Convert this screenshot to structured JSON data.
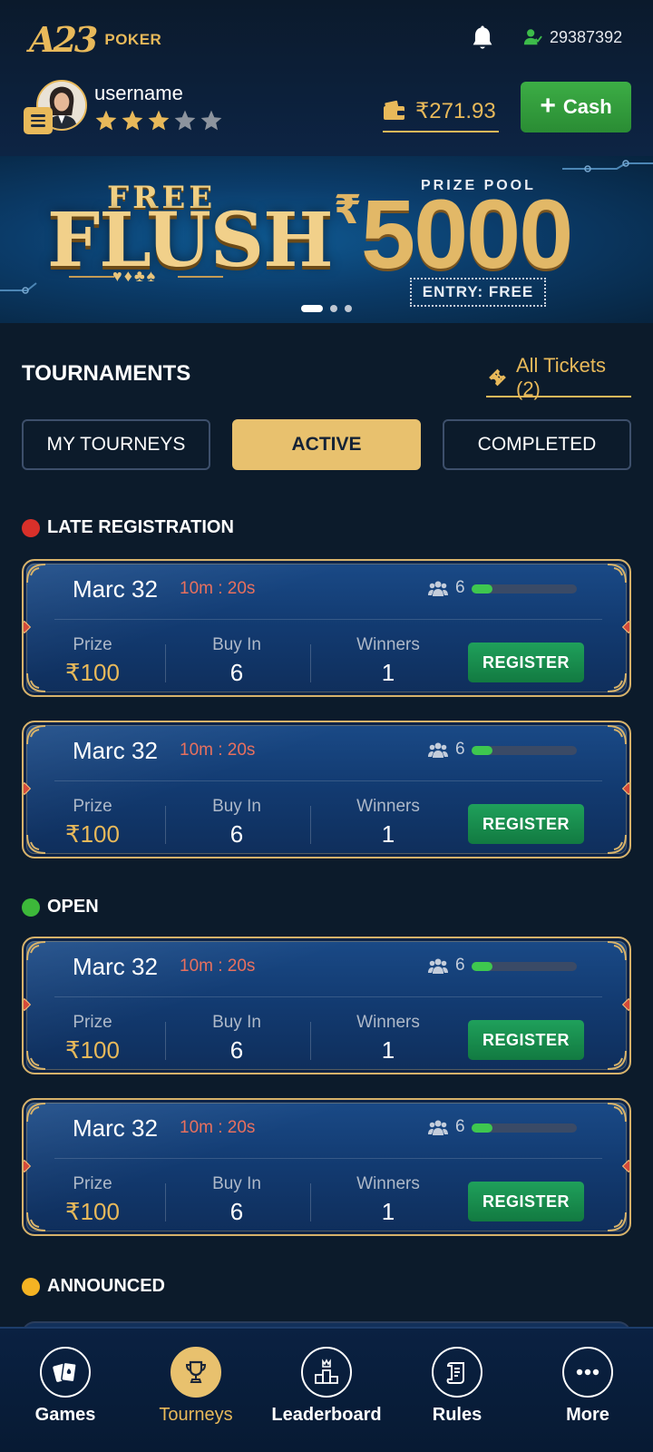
{
  "header": {
    "logo_mark": "A23",
    "logo_text": "POKER",
    "player_id": "29387392",
    "username": "username",
    "star_rating": 3,
    "star_total": 5,
    "wallet_amount": "₹271.93",
    "cash_button_plus": "+",
    "cash_button_label": "Cash"
  },
  "banner": {
    "free": "FREE",
    "flush": "FLUSH",
    "suits": "♥♦♣♠",
    "prize_label": "PRIZE POOL",
    "prize_currency": "₹",
    "prize_amount": "5000",
    "entry": "ENTRY: FREE",
    "slide_count": 3,
    "active_slide": 1
  },
  "tournaments": {
    "title": "TOURNAMENTS",
    "tickets_label": "All Tickets (2)",
    "tabs": [
      {
        "label": "MY TOURNEYS",
        "active": false
      },
      {
        "label": "ACTIVE",
        "active": true
      },
      {
        "label": "COMPLETED",
        "active": false
      }
    ]
  },
  "sections": [
    {
      "label": "LATE REGISTRATION",
      "color": "#d9302a"
    },
    {
      "label": "OPEN",
      "color": "#3db83a"
    },
    {
      "label": "ANNOUNCED",
      "color": "#f4b323"
    }
  ],
  "cards": [
    {
      "name": "Marc 32",
      "timer": "10m : 20s",
      "players": "6",
      "fill": 0.2,
      "prize_label": "Prize",
      "prize": "₹100",
      "buyin_label": "Buy In",
      "buyin": "6",
      "winners_label": "Winners",
      "winners": "1",
      "button": "REGISTER"
    },
    {
      "name": "Marc 32",
      "timer": "10m : 20s",
      "players": "6",
      "fill": 0.2,
      "prize_label": "Prize",
      "prize": "₹100",
      "buyin_label": "Buy In",
      "buyin": "6",
      "winners_label": "Winners",
      "winners": "1",
      "button": "REGISTER"
    },
    {
      "name": "Marc 32",
      "timer": "10m : 20s",
      "players": "6",
      "fill": 0.2,
      "prize_label": "Prize",
      "prize": "₹100",
      "buyin_label": "Buy In",
      "buyin": "6",
      "winners_label": "Winners",
      "winners": "1",
      "button": "REGISTER"
    },
    {
      "name": "Marc 32",
      "timer": "10m : 20s",
      "players": "6",
      "fill": 0.2,
      "prize_label": "Prize",
      "prize": "₹100",
      "buyin_label": "Buy In",
      "buyin": "6",
      "winners_label": "Winners",
      "winners": "1",
      "button": "REGISTER"
    }
  ],
  "nav": [
    {
      "label": "Games",
      "icon": "cards-icon",
      "active": false
    },
    {
      "label": "Tourneys",
      "icon": "trophy-icon",
      "active": true
    },
    {
      "label": "Leaderboard",
      "icon": "podium-icon",
      "active": false
    },
    {
      "label": "Rules",
      "icon": "scroll-icon",
      "active": false
    },
    {
      "label": "More",
      "icon": "more-dots-icon",
      "active": false
    }
  ],
  "colors": {
    "accent_gold": "#e8b95a",
    "cash_green": "#2e9a3a",
    "register_green": "#15894c",
    "timer_red": "#e8705e",
    "background": "#0c1b2b"
  }
}
